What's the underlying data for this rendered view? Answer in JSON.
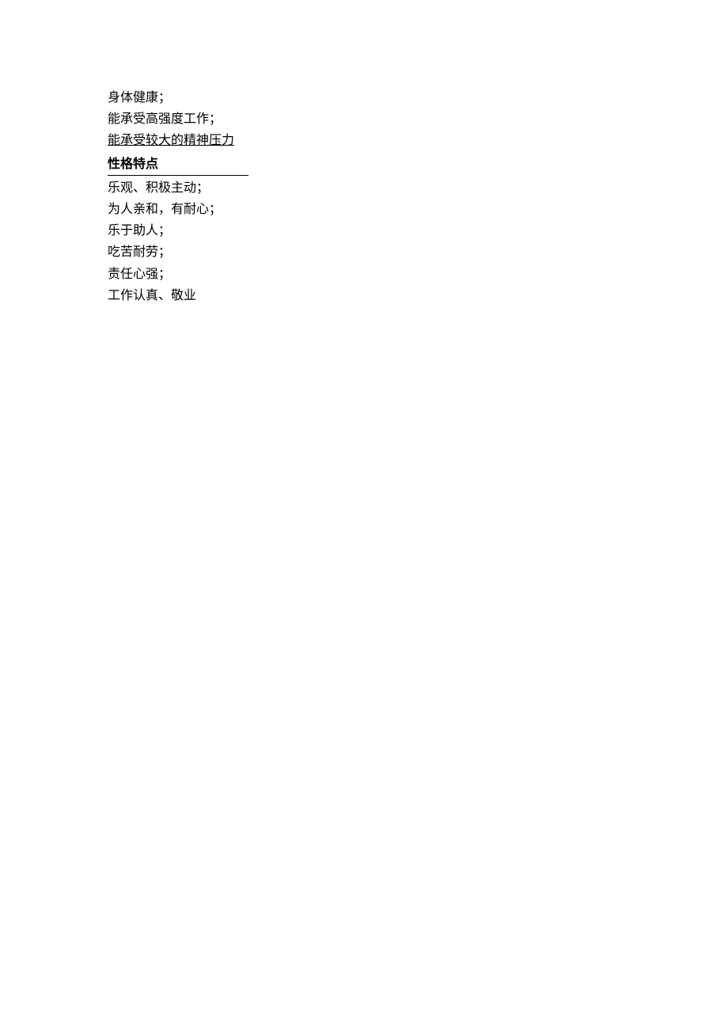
{
  "intro": {
    "line1": "身体健康；",
    "line2": "能承受高强度工作；",
    "line3": "能承受较大的精神压力"
  },
  "section": {
    "heading": "性格特点"
  },
  "traits": {
    "item1": "乐观、积极主动；",
    "item2": "为人亲和，有耐心；",
    "item3": "乐于助人；",
    "item4": "吃苦耐劳；",
    "item5": "责任心强；",
    "item6": "工作认真、敬业"
  }
}
